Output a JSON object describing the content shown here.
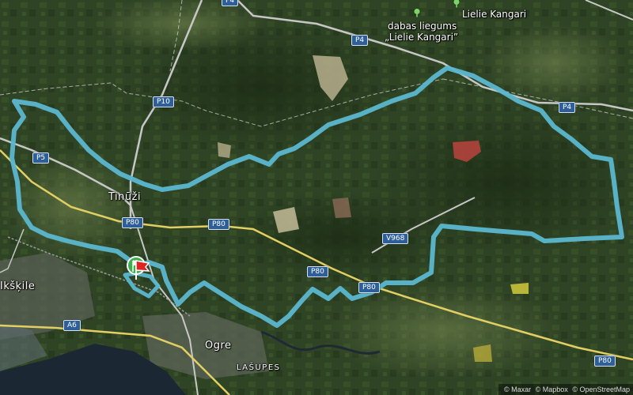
{
  "map": {
    "kind": "satellite",
    "route_color": "#5bb7cf",
    "road_color": "#e8d36a",
    "river_color": "#1e2a3a"
  },
  "places": {
    "tinuzi": "Tinūži",
    "ikskile": "Ikšķile",
    "ogre": "Ogre",
    "lasupes": "LAŠUPES",
    "lielie_kangari": "Lielie Kangari",
    "reserve_line1": "dabas liegums",
    "reserve_line2": "„Lielie Kangari”"
  },
  "road_labels": {
    "p4_top": "P4",
    "p4_right": "P4",
    "p10": "P10",
    "p5": "P5",
    "p80_a": "P80",
    "p80_b": "P80",
    "p80_c": "P80",
    "p80_d": "P80",
    "p80_e": "P80",
    "v968": "V968",
    "a6": "A6"
  },
  "icons": {
    "reserve": "tree-icon",
    "lielie_kangari": "tree-icon",
    "start_flag": "start-flag-icon",
    "finish_flag": "finish-flag-icon"
  },
  "attribution": {
    "maxar": "© Maxar",
    "mapbox": "© Mapbox",
    "osm": "© OpenStreetMap"
  }
}
